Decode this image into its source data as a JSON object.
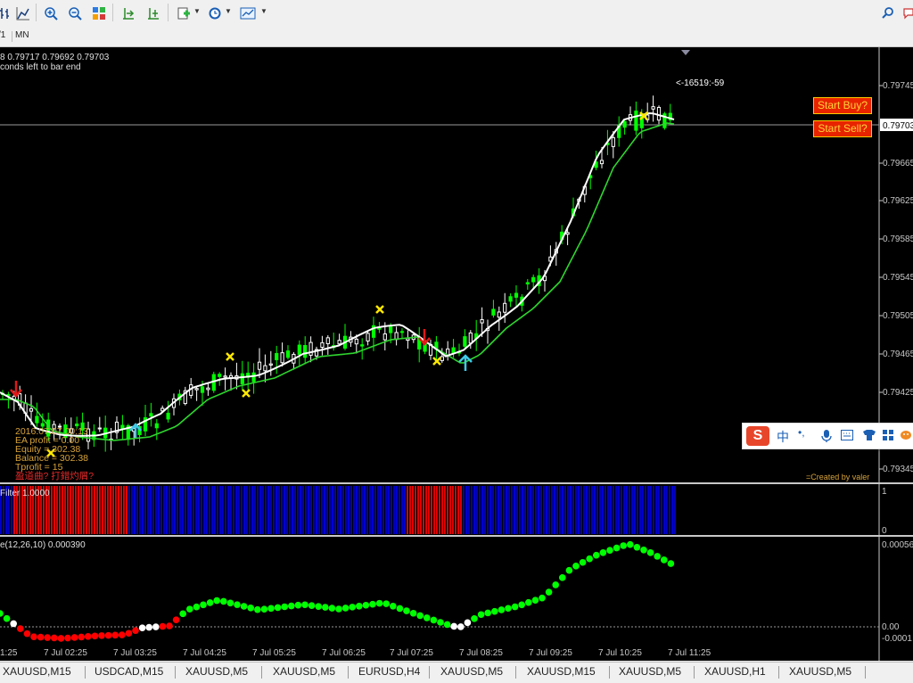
{
  "toolbar": {
    "icons": [
      "bar-chart-icon",
      "line-chart-icon",
      "zoom-in-icon",
      "zoom-out-icon",
      "tile-windows-icon",
      "period-separators-icon",
      "auto-scroll-icon",
      "indicators-icon",
      "clock-icon",
      "templates-icon",
      "search-icon",
      "chat-icon"
    ]
  },
  "timeframes": [
    "/1",
    "MN"
  ],
  "chart": {
    "info_line1": "8 0.79717 0.79692 0.79703",
    "info_line2": "conds left to bar end",
    "spread_label": "<-16519:-59",
    "current_price": "0.79703",
    "buttons": {
      "buy": "Start Buy?",
      "sell": "Start Sell?"
    },
    "price_labels": [
      "0.79745",
      "0.79665",
      "0.79625",
      "0.79585",
      "0.79545",
      "0.79505",
      "0.79465",
      "0.79425",
      "0.79345"
    ],
    "ea_panel": [
      "2016.07.07 00:13",
      "EA profit = 0.00",
      "Equity = 302.38",
      "Balance = 302.38",
      "Tprofit = 15"
    ],
    "ea_warning": "盈道曲? 打錯灼屑?",
    "created_by": "=Created by valer",
    "filter_label": "Filter 1.0000",
    "filter_scale": [
      "1",
      "0"
    ],
    "osma_label": "e(12,26,10) 0.000390",
    "osma_scale": [
      "0.00056",
      "0.00",
      "-0.0001"
    ],
    "time_labels": [
      "1:25",
      "7 Jul 02:25",
      "7 Jul 03:25",
      "7 Jul 04:25",
      "7 Jul 05:25",
      "7 Jul 06:25",
      "7 Jul 07:25",
      "7 Jul 08:25",
      "7 Jul 09:25",
      "7 Jul 10:25",
      "7 Jul 11:25"
    ],
    "colors": {
      "bull": "#ffffff",
      "bear": "#00ff00",
      "ma_fast": "#ffffff",
      "ma_slow": "#2fd52f",
      "filter_blue": "#0000c8",
      "filter_red": "#e00000",
      "osma_up": "#00ff00",
      "osma_down": "#ff0000",
      "cross": "#ffff00"
    }
  },
  "ime": {
    "logo": "S",
    "lang": "中",
    "punct": "•,"
  },
  "tabs": [
    "XAUUSD,M15",
    "USDCAD,M15",
    "XAUUSD,M5",
    "XAUUSD,M5",
    "EURUSD,H4",
    "XAUUSD,M5",
    "XAUUSD,M15",
    "XAUUSD,M5",
    "XAUUSD,H1",
    "XAUUSD,M5"
  ]
}
